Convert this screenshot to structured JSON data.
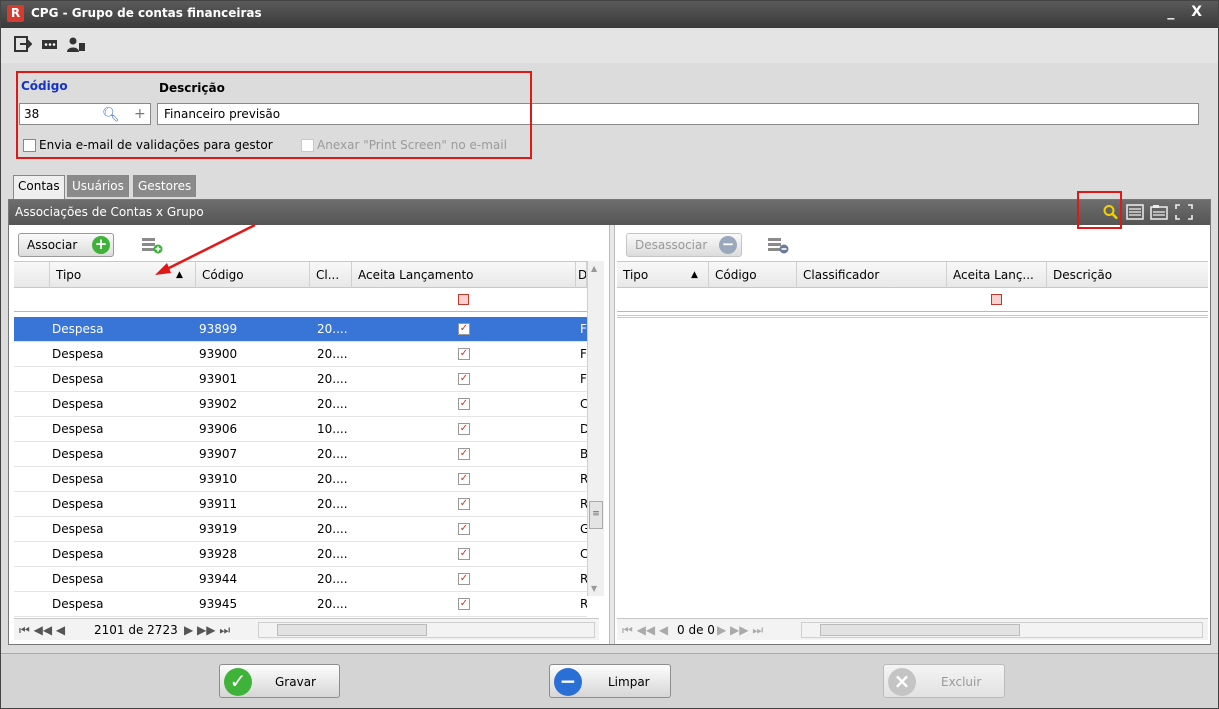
{
  "window": {
    "title": "CPG - Grupo de contas financeiras",
    "controls": "_ X"
  },
  "form": {
    "codigo_label": "Código",
    "descricao_label": "Descrição",
    "codigo_value": "38",
    "descricao_value": "Financeiro previsão",
    "email_check_label": "Envia e-mail de validações para gestor",
    "print_check_label": "Anexar \"Print Screen\" no e-mail"
  },
  "tabs": [
    "Contas",
    "Usuários",
    "Gestores"
  ],
  "panel": {
    "title": "Associações de Contas x Grupo"
  },
  "left": {
    "associar_label": "Associar",
    "columns": [
      "Tipo",
      "Código",
      "Cl...",
      "Aceita Lançamento",
      "D"
    ],
    "rows": [
      [
        "Despesa",
        "93899",
        "20....",
        "F"
      ],
      [
        "Despesa",
        "93900",
        "20....",
        "F"
      ],
      [
        "Despesa",
        "93901",
        "20....",
        "F"
      ],
      [
        "Despesa",
        "93902",
        "20....",
        "C"
      ],
      [
        "Despesa",
        "93906",
        "10....",
        "D"
      ],
      [
        "Despesa",
        "93907",
        "20....",
        "B"
      ],
      [
        "Despesa",
        "93910",
        "20....",
        "R"
      ],
      [
        "Despesa",
        "93911",
        "20....",
        "R"
      ],
      [
        "Despesa",
        "93919",
        "20....",
        "G"
      ],
      [
        "Despesa",
        "93928",
        "20....",
        "C"
      ],
      [
        "Despesa",
        "93944",
        "20....",
        "R"
      ],
      [
        "Despesa",
        "93945",
        "20....",
        "R"
      ]
    ],
    "pager_text": "2101 de 2723"
  },
  "right": {
    "desassociar_label": "Desassociar",
    "columns": [
      "Tipo",
      "Código",
      "Classificador",
      "Aceita Lanç...",
      "Descrição"
    ],
    "pager_text": "0 de 0"
  },
  "footer": {
    "gravar": "Gravar",
    "limpar": "Limpar",
    "excluir": "Excluir"
  },
  "colors": {
    "selection": "#3875d7",
    "highlight_box": "#e01818",
    "gravar_icon": "#3fb23a",
    "limpar_icon": "#2a6fd6"
  }
}
